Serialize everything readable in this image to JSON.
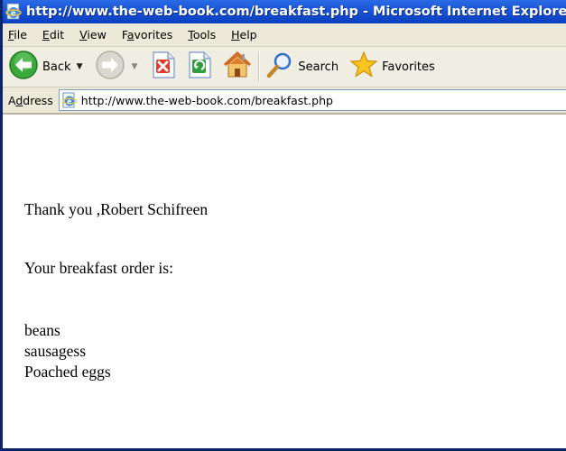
{
  "window": {
    "title": "http://www.the-web-book.com/breakfast.php - Microsoft Internet Explorer"
  },
  "menu": {
    "items": [
      {
        "label": "File",
        "accel": "F",
        "rest": "ile"
      },
      {
        "label": "Edit",
        "accel": "E",
        "rest": "dit"
      },
      {
        "label": "View",
        "accel": "V",
        "rest": "iew"
      },
      {
        "label": "Favorites",
        "pre": "F",
        "accel": "a",
        "rest": "vorites"
      },
      {
        "label": "Tools",
        "accel": "T",
        "rest": "ools"
      },
      {
        "label": "Help",
        "accel": "H",
        "rest": "elp"
      }
    ]
  },
  "toolbar": {
    "back_label": "Back",
    "search_label": "Search",
    "favorites_label": "Favorites"
  },
  "address": {
    "label_pre": "A",
    "label_accel": "d",
    "label_rest": "dress",
    "url": "http://www.the-web-book.com/breakfast.php"
  },
  "page": {
    "thanks": "Thank you ,Robert Schifreen",
    "order_heading": "Your breakfast order is:",
    "order_items": [
      "beans",
      "sausagess",
      "Poached eggs"
    ]
  },
  "colors": {
    "titlebar": "#0a3fc0",
    "chrome": "#ece9d8",
    "window_border": "#0a246a"
  },
  "icons": [
    "ie-page-icon",
    "back-arrow-icon",
    "forward-arrow-icon",
    "stop-icon",
    "refresh-icon",
    "home-icon",
    "search-magnifier-icon",
    "favorites-star-icon"
  ]
}
